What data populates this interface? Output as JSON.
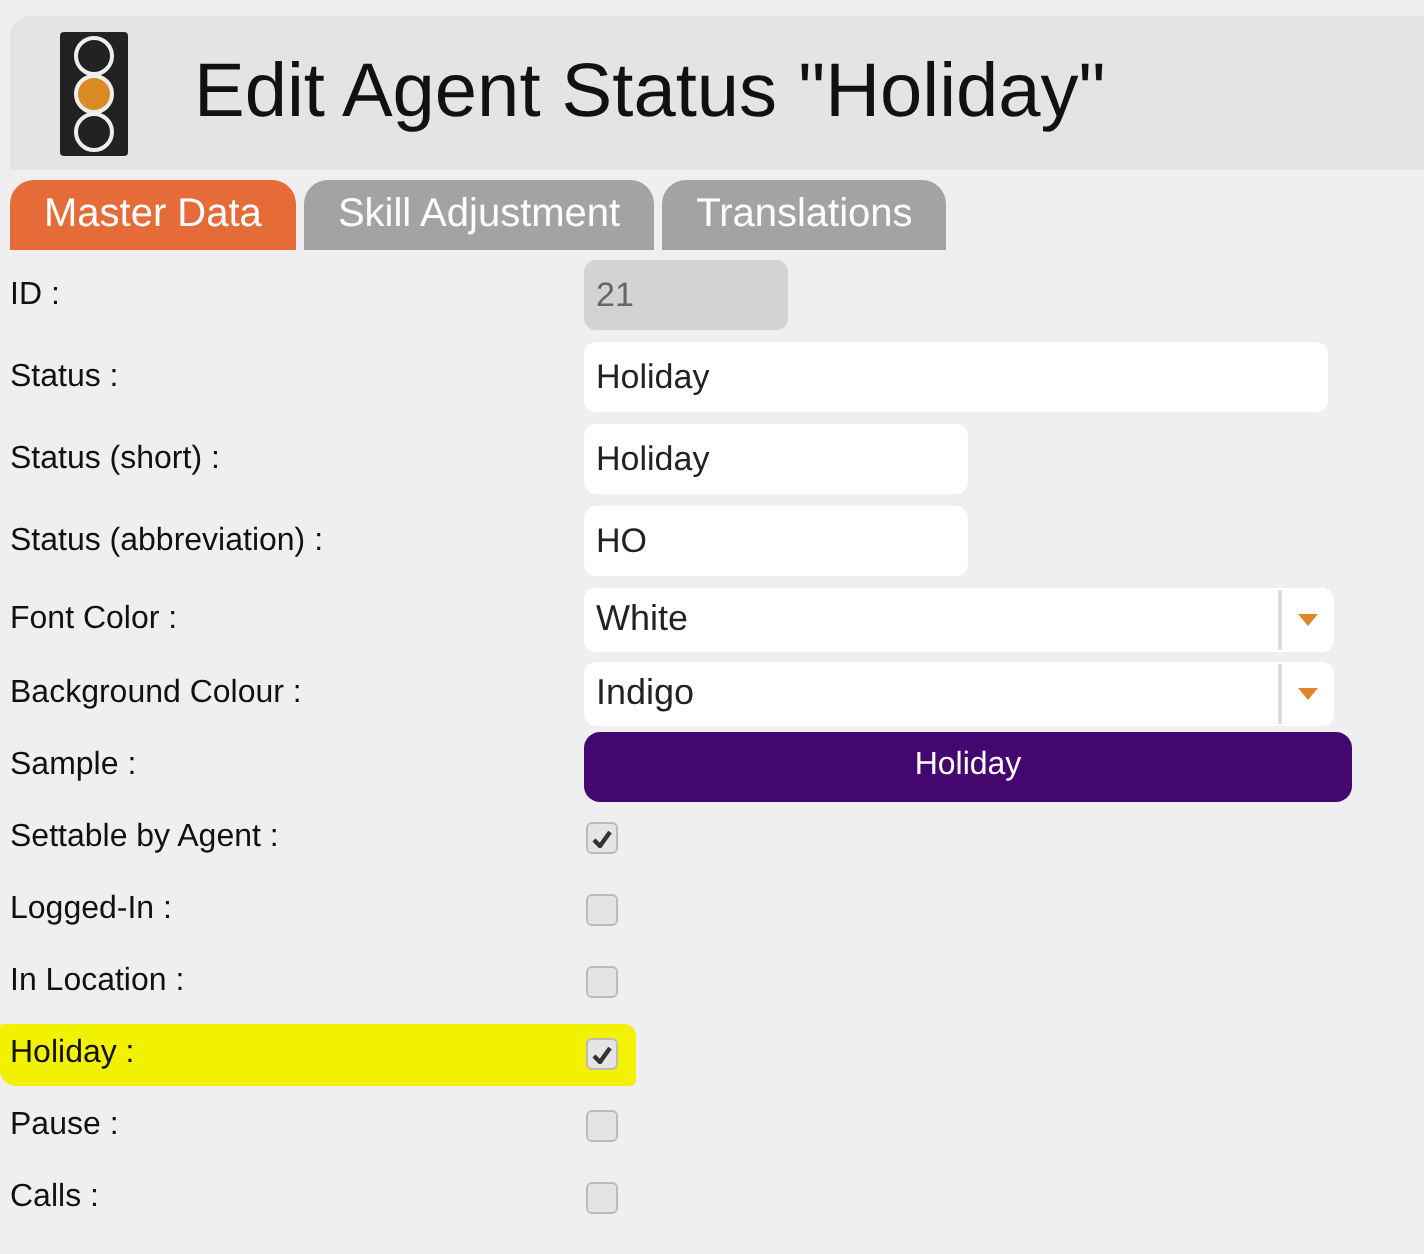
{
  "header": {
    "title": "Edit Agent Status \"Holiday\""
  },
  "tabs": [
    {
      "label": "Master Data",
      "selected": true
    },
    {
      "label": "Skill Adjustment",
      "selected": false
    },
    {
      "label": "Translations",
      "selected": false
    }
  ],
  "rows": [
    {
      "kind": "short-field",
      "label": "ID :",
      "value": "21",
      "disabled": true
    },
    {
      "kind": "long-field",
      "label": "Status :",
      "value": "Holiday",
      "disabled": false
    },
    {
      "kind": "short-field",
      "label": "Status (short) :",
      "value": "Holiday",
      "disabled": false
    },
    {
      "kind": "short-field",
      "label": "Status (abbreviation) :",
      "value": "HO",
      "disabled": false
    },
    {
      "kind": "select",
      "label": "Font Color :",
      "value": "White"
    },
    {
      "kind": "select",
      "label": "Background Colour :",
      "value": "Indigo"
    },
    {
      "kind": "sample",
      "label": "Sample :",
      "value": "Holiday",
      "color": "#43076f"
    },
    {
      "kind": "checkbox",
      "label": "Settable by Agent :",
      "checked": true,
      "highlighted": false
    },
    {
      "kind": "checkbox",
      "label": "Logged-In :",
      "checked": false,
      "highlighted": false
    },
    {
      "kind": "checkbox",
      "label": "In Location :",
      "checked": false,
      "highlighted": false
    },
    {
      "kind": "checkbox",
      "label": "Holiday :",
      "checked": true,
      "highlighted": true
    },
    {
      "kind": "checkbox",
      "label": "Pause :",
      "checked": false,
      "highlighted": false
    },
    {
      "kind": "checkbox",
      "label": "Calls :",
      "checked": false,
      "highlighted": false
    }
  ]
}
